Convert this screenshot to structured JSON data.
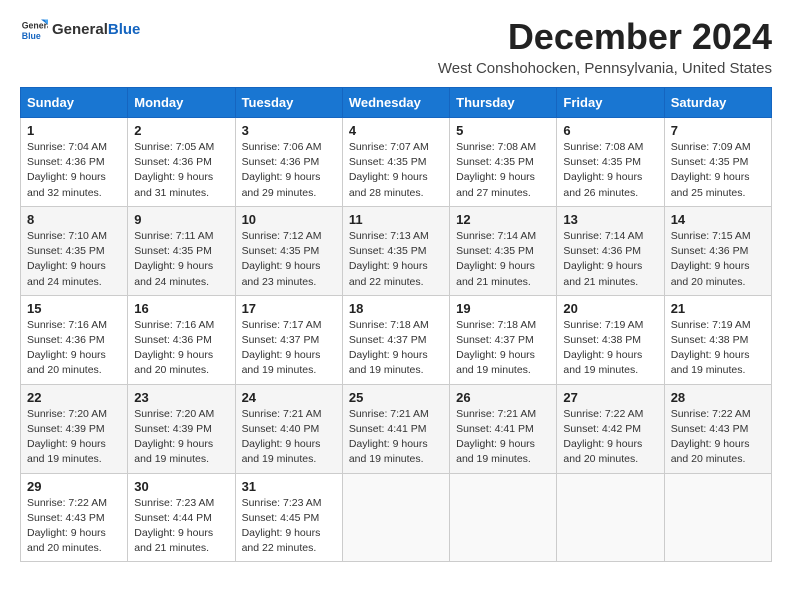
{
  "header": {
    "logo_general": "General",
    "logo_blue": "Blue",
    "title": "December 2024",
    "subtitle": "West Conshohocken, Pennsylvania, United States"
  },
  "weekdays": [
    "Sunday",
    "Monday",
    "Tuesday",
    "Wednesday",
    "Thursday",
    "Friday",
    "Saturday"
  ],
  "weeks": [
    [
      {
        "day": "1",
        "sunrise": "7:04 AM",
        "sunset": "4:36 PM",
        "daylight": "9 hours and 32 minutes."
      },
      {
        "day": "2",
        "sunrise": "7:05 AM",
        "sunset": "4:36 PM",
        "daylight": "9 hours and 31 minutes."
      },
      {
        "day": "3",
        "sunrise": "7:06 AM",
        "sunset": "4:36 PM",
        "daylight": "9 hours and 29 minutes."
      },
      {
        "day": "4",
        "sunrise": "7:07 AM",
        "sunset": "4:35 PM",
        "daylight": "9 hours and 28 minutes."
      },
      {
        "day": "5",
        "sunrise": "7:08 AM",
        "sunset": "4:35 PM",
        "daylight": "9 hours and 27 minutes."
      },
      {
        "day": "6",
        "sunrise": "7:08 AM",
        "sunset": "4:35 PM",
        "daylight": "9 hours and 26 minutes."
      },
      {
        "day": "7",
        "sunrise": "7:09 AM",
        "sunset": "4:35 PM",
        "daylight": "9 hours and 25 minutes."
      }
    ],
    [
      {
        "day": "8",
        "sunrise": "7:10 AM",
        "sunset": "4:35 PM",
        "daylight": "9 hours and 24 minutes."
      },
      {
        "day": "9",
        "sunrise": "7:11 AM",
        "sunset": "4:35 PM",
        "daylight": "9 hours and 24 minutes."
      },
      {
        "day": "10",
        "sunrise": "7:12 AM",
        "sunset": "4:35 PM",
        "daylight": "9 hours and 23 minutes."
      },
      {
        "day": "11",
        "sunrise": "7:13 AM",
        "sunset": "4:35 PM",
        "daylight": "9 hours and 22 minutes."
      },
      {
        "day": "12",
        "sunrise": "7:14 AM",
        "sunset": "4:35 PM",
        "daylight": "9 hours and 21 minutes."
      },
      {
        "day": "13",
        "sunrise": "7:14 AM",
        "sunset": "4:36 PM",
        "daylight": "9 hours and 21 minutes."
      },
      {
        "day": "14",
        "sunrise": "7:15 AM",
        "sunset": "4:36 PM",
        "daylight": "9 hours and 20 minutes."
      }
    ],
    [
      {
        "day": "15",
        "sunrise": "7:16 AM",
        "sunset": "4:36 PM",
        "daylight": "9 hours and 20 minutes."
      },
      {
        "day": "16",
        "sunrise": "7:16 AM",
        "sunset": "4:36 PM",
        "daylight": "9 hours and 20 minutes."
      },
      {
        "day": "17",
        "sunrise": "7:17 AM",
        "sunset": "4:37 PM",
        "daylight": "9 hours and 19 minutes."
      },
      {
        "day": "18",
        "sunrise": "7:18 AM",
        "sunset": "4:37 PM",
        "daylight": "9 hours and 19 minutes."
      },
      {
        "day": "19",
        "sunrise": "7:18 AM",
        "sunset": "4:37 PM",
        "daylight": "9 hours and 19 minutes."
      },
      {
        "day": "20",
        "sunrise": "7:19 AM",
        "sunset": "4:38 PM",
        "daylight": "9 hours and 19 minutes."
      },
      {
        "day": "21",
        "sunrise": "7:19 AM",
        "sunset": "4:38 PM",
        "daylight": "9 hours and 19 minutes."
      }
    ],
    [
      {
        "day": "22",
        "sunrise": "7:20 AM",
        "sunset": "4:39 PM",
        "daylight": "9 hours and 19 minutes."
      },
      {
        "day": "23",
        "sunrise": "7:20 AM",
        "sunset": "4:39 PM",
        "daylight": "9 hours and 19 minutes."
      },
      {
        "day": "24",
        "sunrise": "7:21 AM",
        "sunset": "4:40 PM",
        "daylight": "9 hours and 19 minutes."
      },
      {
        "day": "25",
        "sunrise": "7:21 AM",
        "sunset": "4:41 PM",
        "daylight": "9 hours and 19 minutes."
      },
      {
        "day": "26",
        "sunrise": "7:21 AM",
        "sunset": "4:41 PM",
        "daylight": "9 hours and 19 minutes."
      },
      {
        "day": "27",
        "sunrise": "7:22 AM",
        "sunset": "4:42 PM",
        "daylight": "9 hours and 20 minutes."
      },
      {
        "day": "28",
        "sunrise": "7:22 AM",
        "sunset": "4:43 PM",
        "daylight": "9 hours and 20 minutes."
      }
    ],
    [
      {
        "day": "29",
        "sunrise": "7:22 AM",
        "sunset": "4:43 PM",
        "daylight": "9 hours and 20 minutes."
      },
      {
        "day": "30",
        "sunrise": "7:23 AM",
        "sunset": "4:44 PM",
        "daylight": "9 hours and 21 minutes."
      },
      {
        "day": "31",
        "sunrise": "7:23 AM",
        "sunset": "4:45 PM",
        "daylight": "9 hours and 22 minutes."
      },
      null,
      null,
      null,
      null
    ]
  ],
  "labels": {
    "sunrise": "Sunrise:",
    "sunset": "Sunset:",
    "daylight": "Daylight:"
  }
}
